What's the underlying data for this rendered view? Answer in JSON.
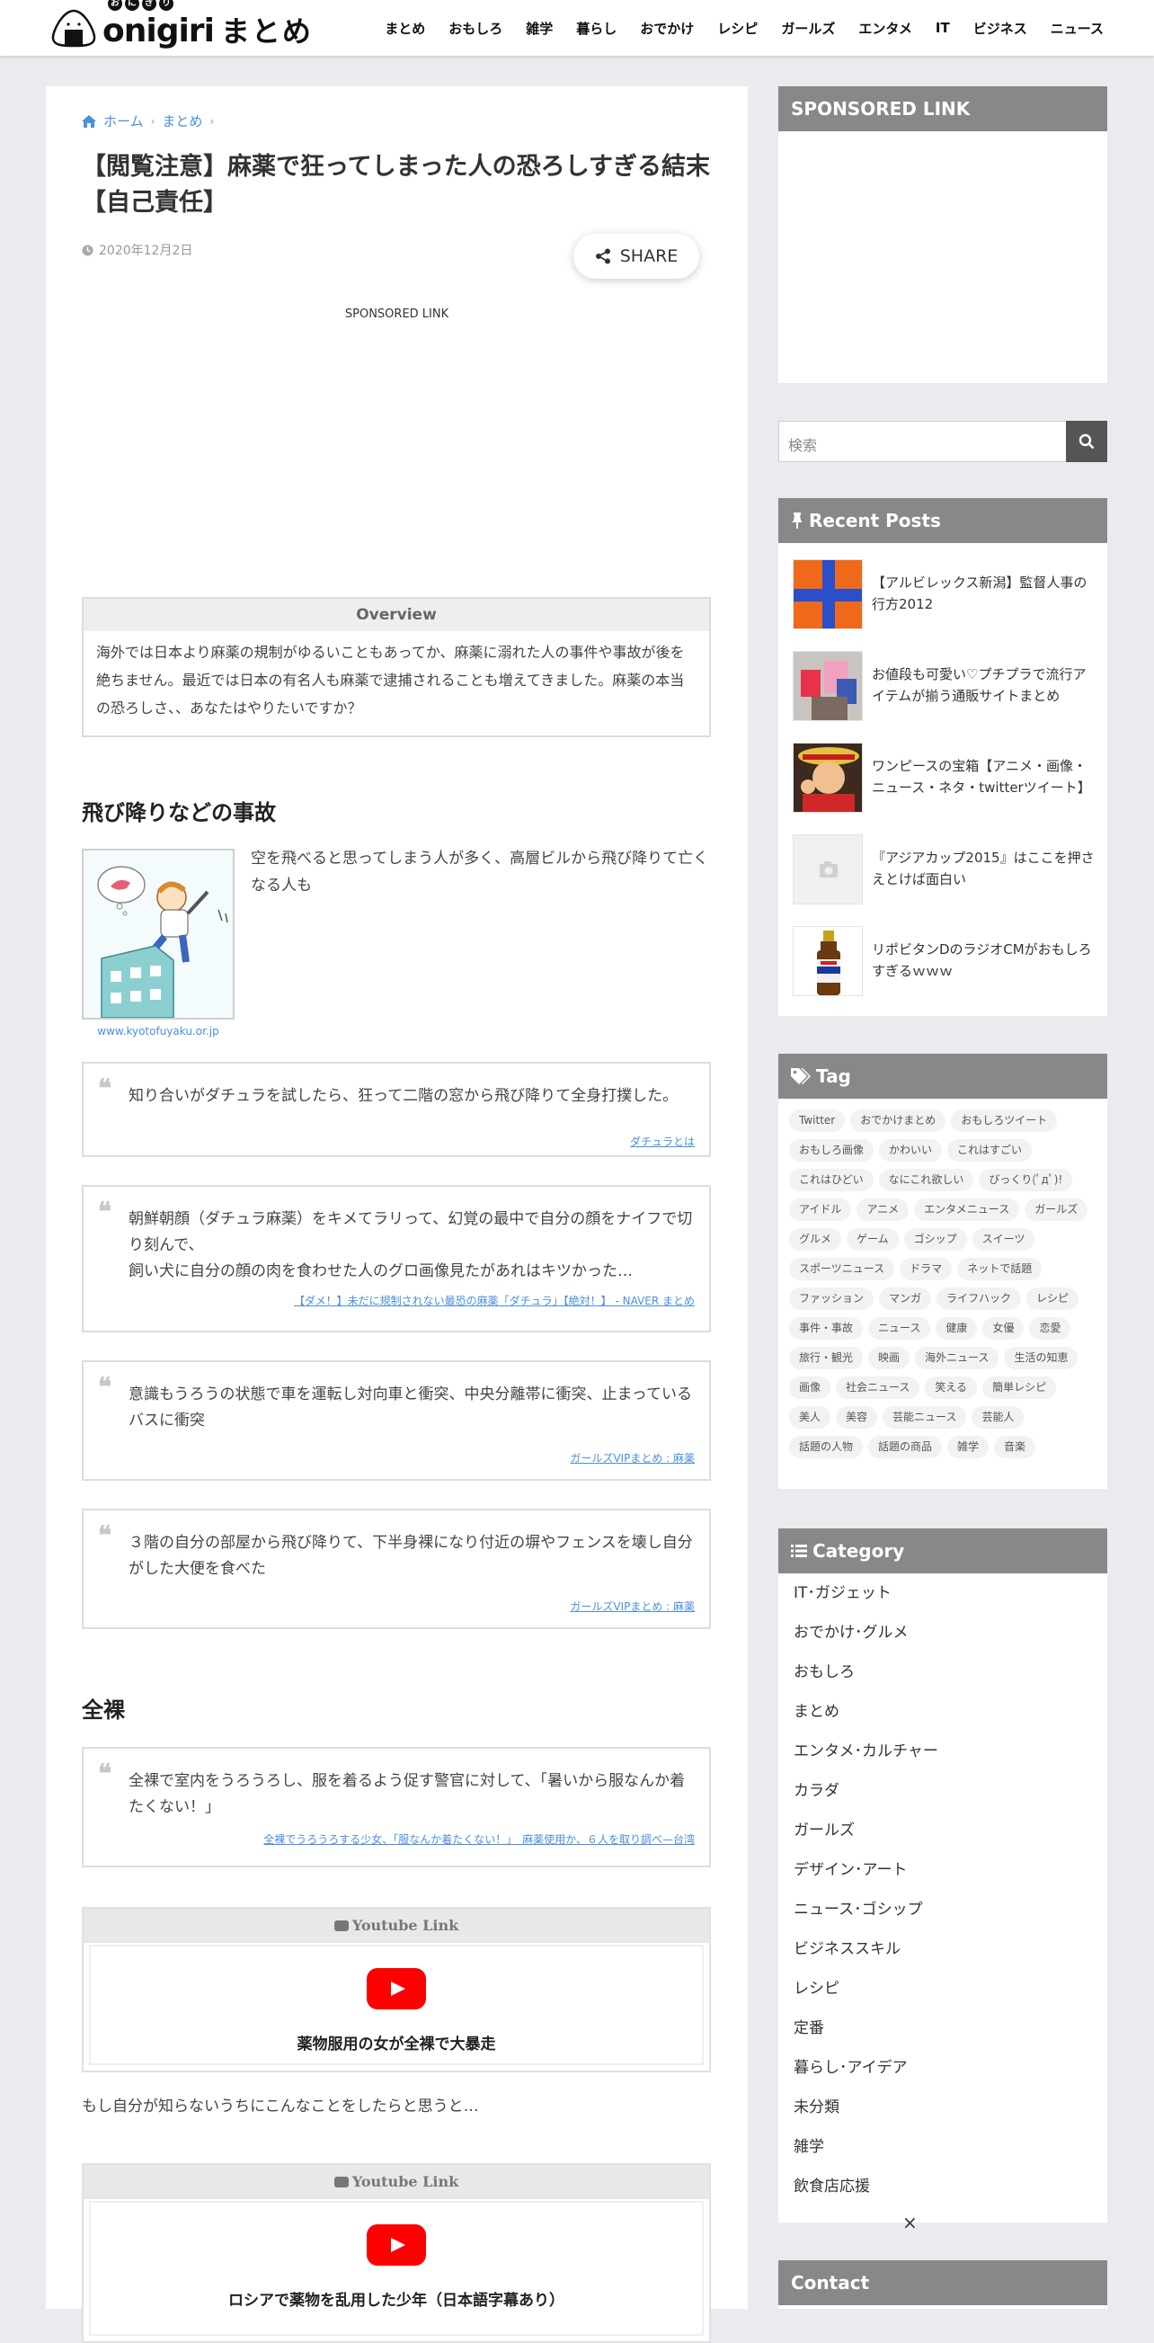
{
  "header": {
    "logo_kana": [
      "お",
      "に",
      "ぎ",
      "り"
    ],
    "logo_word": "onigiri",
    "logo_sub": "まとめ",
    "nav": [
      "まとめ",
      "おもしろ",
      "雑学",
      "暮らし",
      "おでかけ",
      "レシピ",
      "ガールズ",
      "エンタメ",
      "IT",
      "ビジネス",
      "ニュース"
    ]
  },
  "article": {
    "breadcrumb": [
      "ホーム",
      "まとめ"
    ],
    "title": "【閲覧注意】麻薬で狂ってしまった人の恐ろしすぎる結末【自己責任】",
    "date": "2020年12月2日",
    "share_label": "SHARE",
    "sponsored": "SPONSORED LINK",
    "overview_heading": "Overview",
    "overview_text": "海外では日本より麻薬の規制がゆるいこともあってか、麻薬に溺れた人の事件や事故が後を絶ちません。最近では日本の有名人も麻薬で逮捕されることも増えてきました。麻薬の本当の恐ろしさ、、あなたはやりたいですか？",
    "section1": "飛び降りなどの事故",
    "figure_caption": "www.kyotofuyaku.or.jp",
    "figure_text": "空を飛べると思ってしまう人が多く、高層ビルから飛び降りて亡くなる人も",
    "quotes": [
      {
        "text": "知り合いがダチュラを試したら、狂って二階の窓から飛び降りて全身打撲した。",
        "source": "ダチュラとは"
      },
      {
        "text": "朝鮮朝顔（ダチュラ麻薬）をキメてラリって、幻覚の最中で自分の顔をナイフで切り刻んで、\n飼い犬に自分の顔の肉を食わせた人のグロ画像見たがあれはキツかった…",
        "source": "【ダメ！】未だに規制されない最恐の麻薬「ダチュラ」【絶対！】 - NAVER まとめ"
      },
      {
        "text": "意識もうろうの状態で車を運転し対向車と衝突、中央分離帯に衝突、止まっているバスに衝突",
        "source": "ガールズVIPまとめ : 麻薬"
      },
      {
        "text": "３階の自分の部屋から飛び降りて、下半身裸になり付近の塀やフェンスを壊し自分がした大便を食べた",
        "source": "ガールズVIPまとめ : 麻薬"
      }
    ],
    "section2": "全裸",
    "quote5": {
      "text": "全裸で室内をうろうろし、服を着るよう促す警官に対して、「暑いから服なんか着たくない！」",
      "source": "全裸でうろうろする少女、「服なんか着たくない！」　麻薬使用か、６人を取り調べ—台湾"
    },
    "youtube_label": "Youtube Link",
    "video1_title": "薬物服用の女が全裸で大暴走",
    "paragraph": "もし自分が知らないうちにこんなことをしたらと思うと…",
    "video2_title": "ロシアで薬物を乱用した少年（日本語字幕あり）"
  },
  "sidebar": {
    "sponsored": "SPONSORED LINK",
    "search_placeholder": "検索",
    "recent_heading": "Recent Posts",
    "recent_posts": [
      "【アルビレックス新潟】監督人事の行方2012",
      "お値段も可愛い♡プチプラで流行アイテムが揃う通販サイトまとめ",
      "ワンピースの宝箱【アニメ・画像・ニュース・ネタ・twitterツイート】",
      "『アジアカップ2015』はここを押さえとけば面白い",
      "リポビタンDのラジオCMがおもしろすぎるｗｗｗ"
    ],
    "tag_heading": "Tag",
    "tags": [
      "Twitter",
      "おでかけまとめ",
      "おもしろツイート",
      "おもしろ画像",
      "かわいい",
      "これはすごい",
      "これはひどい",
      "なにこれ欲しい",
      "びっくり(ﾟдﾟ)!",
      "アイドル",
      "アニメ",
      "エンタメニュース",
      "ガールズ",
      "グルメ",
      "ゲーム",
      "ゴシップ",
      "スイーツ",
      "スポーツニュース",
      "ドラマ",
      "ネットで話題",
      "ファッション",
      "マンガ",
      "ライフハック",
      "レシピ",
      "事件・事故",
      "ニュース",
      "健康",
      "女優",
      "恋愛",
      "旅行・観光",
      "映画",
      "海外ニュース",
      "生活の知恵",
      "画像",
      "社会ニュース",
      "笑える",
      "簡単レシピ",
      "美人",
      "美容",
      "芸能ニュース",
      "芸能人",
      "話題の人物",
      "話題の商品",
      "雑学",
      "音楽"
    ],
    "category_heading": "Category",
    "categories": [
      "IT･ガジェット",
      "おでかけ･グルメ",
      "おもしろ",
      "まとめ",
      "エンタメ･カルチャー",
      "カラダ",
      "ガールズ",
      "デザイン･アート",
      "ニュース･ゴシップ",
      "ビジネススキル",
      "レシピ",
      "定番",
      "暮らし･アイデア",
      "未分類",
      "雑学",
      "飲食店応援"
    ],
    "contact_heading": "Contact"
  },
  "close_glyph": "×"
}
